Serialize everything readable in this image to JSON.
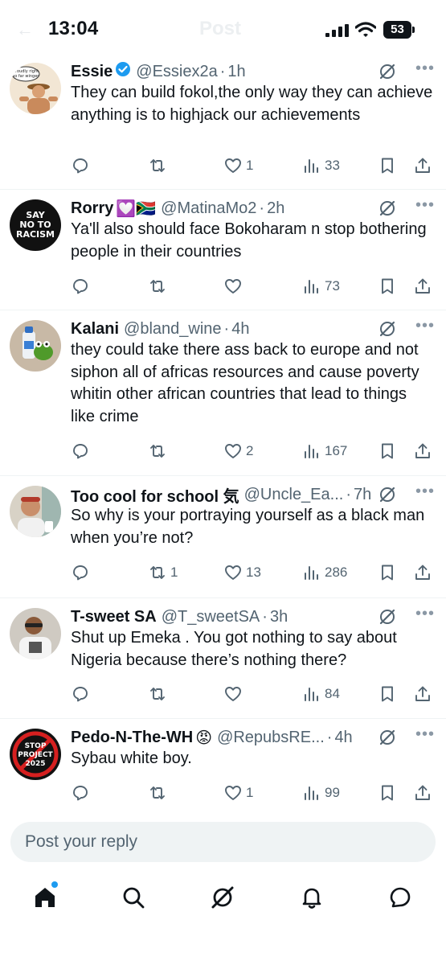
{
  "status_bar": {
    "time": "13:04",
    "battery": "53",
    "ghost_title": "Post"
  },
  "colors": {
    "accent": "#1d9bf0",
    "text": "#0f1419",
    "muted": "#536471",
    "divider": "#eff3f4"
  },
  "replies": [
    {
      "name": "Essie",
      "badge": "verified-icon",
      "handle": "@Essiex2a",
      "sep": "·",
      "time": "1h",
      "text": "They can build fokol,the only way they can achieve anything is to highjack our achievements",
      "reply_count": "",
      "repost_count": "",
      "like_count": "1",
      "views": "33"
    },
    {
      "name": "Rorry",
      "badge": "💟🇿🇦",
      "handle": "@MatinaMo2",
      "sep": "·",
      "time": "2h",
      "text": "Ya'll also should face Bokoharam n stop bothering people in their countries",
      "reply_count": "",
      "repost_count": "",
      "like_count": "",
      "views": "73"
    },
    {
      "name": "Kalani",
      "badge": "",
      "handle": "@bland_wine",
      "sep": "·",
      "time": "4h",
      "text": "they could take there ass back to europe and not siphon all of africas resources and cause poverty whitin other african countries that lead to things like crime",
      "reply_count": "",
      "repost_count": "",
      "like_count": "2",
      "views": "167"
    },
    {
      "name": "Too cool for school 気",
      "badge": "",
      "handle": "@Uncle_Ea...",
      "sep": "·",
      "time": "7h",
      "text": "So why is your portraying yourself as a black man when you’re not?",
      "reply_count": "",
      "repost_count": "1",
      "like_count": "13",
      "views": "286"
    },
    {
      "name": "T-sweet SA",
      "badge": "",
      "handle": "@T_sweetSA",
      "sep": "·",
      "time": "3h",
      "text": "Shut up Emeka . You got nothing to say about Nigeria because there’s nothing there?",
      "reply_count": "",
      "repost_count": "",
      "like_count": "",
      "views": "84"
    },
    {
      "name": "Pedo-N-The-WH",
      "badge": "😡",
      "handle": "@RepubsRE...",
      "sep": "·",
      "time": "4h",
      "text": "Sybau white boy.",
      "reply_count": "",
      "repost_count": "",
      "like_count": "1",
      "views": "99"
    }
  ],
  "avatars": {
    "essie": "proudly right so far winger",
    "rorry": [
      "SAY",
      "NO TO",
      "RACISM"
    ],
    "pedo": [
      "STOP",
      "PROJECT",
      "2025"
    ]
  },
  "compose": {
    "placeholder": "Post your reply"
  },
  "nav": [
    "home-icon",
    "search-icon",
    "grok-icon",
    "bell-icon",
    "messages-icon"
  ]
}
